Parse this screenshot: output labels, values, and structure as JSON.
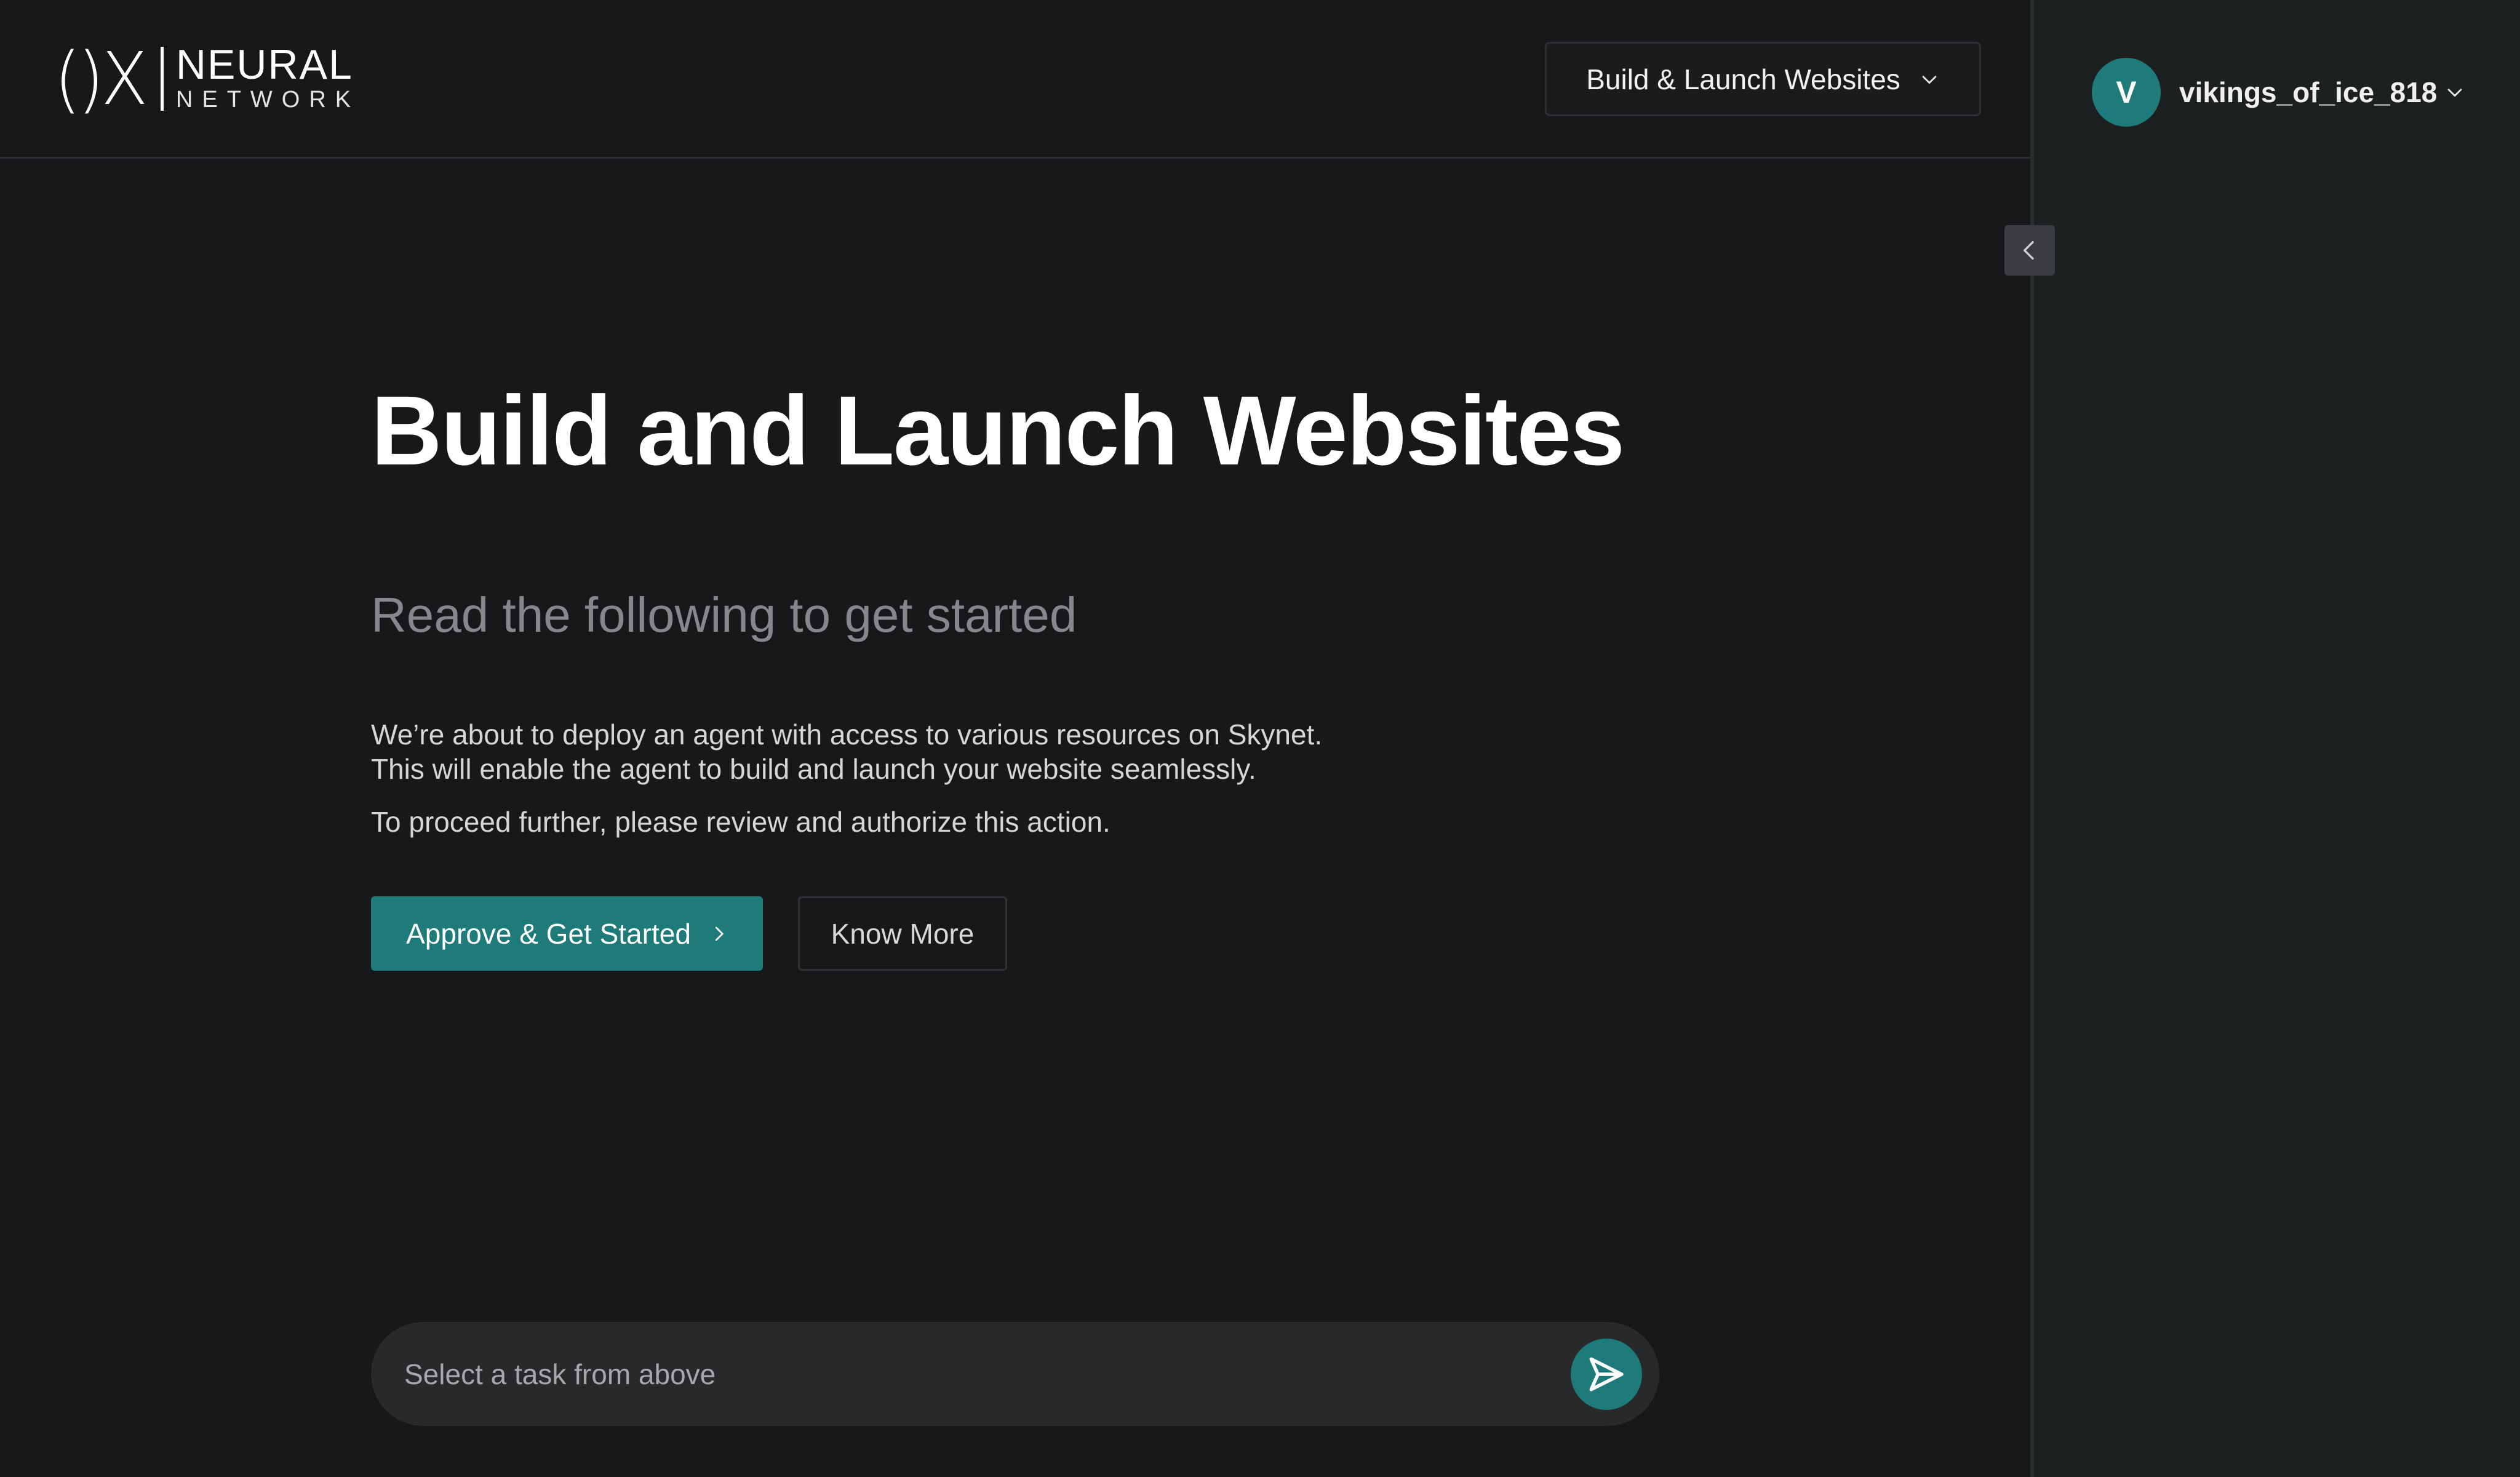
{
  "logo": {
    "mark": "()X",
    "line1": "NEURAL",
    "line2": "NETWORK"
  },
  "header": {
    "task_dropdown_label": "Build & Launch Websites"
  },
  "main": {
    "title": "Build and Launch Websites",
    "subtitle": "Read the following to get started",
    "description_line1": "We’re about to deploy an agent with access to various resources on Skynet.",
    "description_line2": "This will enable the agent to build and launch your website seamlessly.",
    "description_line3": "To proceed further, please review and authorize this action.",
    "primary_button": "Approve & Get Started",
    "secondary_button": "Know More"
  },
  "chat": {
    "placeholder": "Select a task from above"
  },
  "sidebar": {
    "avatar_initial": "V",
    "username": "vikings_of_ice_818"
  },
  "icons": {
    "dropdown": "chevron-down-icon",
    "collapse": "chevron-left-icon",
    "button_arrow": "chevron-right-icon",
    "send": "send-icon",
    "user_menu": "chevron-down-icon"
  },
  "colors": {
    "background": "#17181a",
    "sidebar": "#1d2021",
    "accent": "#1f7a7a",
    "muted_text": "#85878a"
  }
}
